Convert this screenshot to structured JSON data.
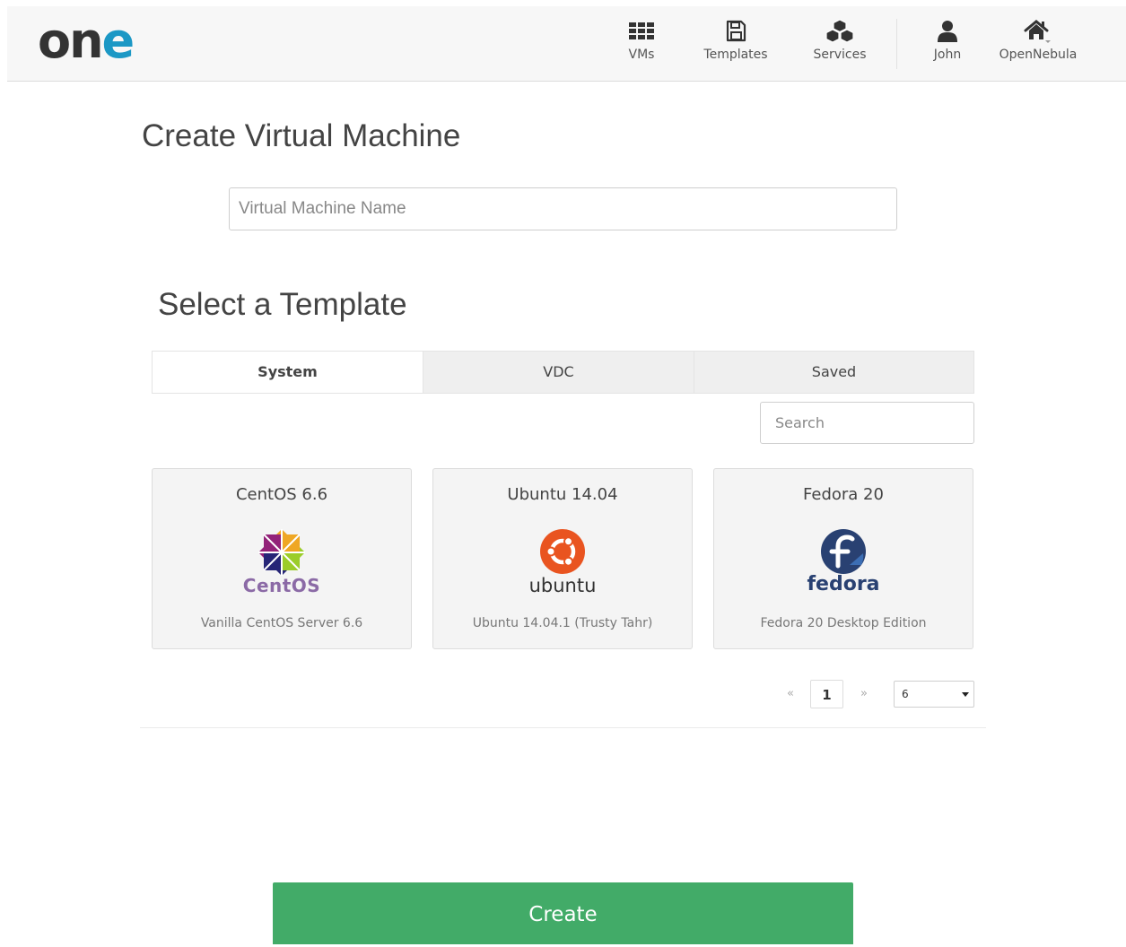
{
  "header": {
    "logo_text_dark": "on",
    "logo_text_accent": "e",
    "nav": [
      {
        "label": "VMs",
        "icon": "grid-icon"
      },
      {
        "label": "Templates",
        "icon": "floppy-icon"
      },
      {
        "label": "Services",
        "icon": "cubes-icon"
      },
      {
        "label": "John",
        "icon": "user-icon"
      },
      {
        "label": "OpenNebula",
        "icon": "home-icon"
      }
    ]
  },
  "main": {
    "title": "Create Virtual Machine",
    "vm_name_placeholder": "Virtual Machine Name",
    "select_title": "Select a Template",
    "tabs": [
      {
        "label": "System",
        "active": true
      },
      {
        "label": "VDC",
        "active": false
      },
      {
        "label": "Saved",
        "active": false
      }
    ],
    "search_placeholder": "Search",
    "templates": [
      {
        "name": "CentOS 6.6",
        "logo_text": "CentOS",
        "description": "Vanilla CentOS Server 6.6"
      },
      {
        "name": "Ubuntu 14.04",
        "logo_text": "ubuntu",
        "description": "Ubuntu 14.04.1 (Trusty Tahr)"
      },
      {
        "name": "Fedora 20",
        "logo_text": "fedora",
        "description": "Fedora 20 Desktop Edition"
      }
    ],
    "pagination": {
      "prev": "«",
      "current": "1",
      "next": "»",
      "page_size": "6"
    },
    "create_label": "Create"
  },
  "colors": {
    "accent_blue": "#1c98c5",
    "create_green": "#42ab68",
    "ubuntu_orange": "#e95420",
    "fedora_blue": "#294172",
    "centos_purple": "#932279"
  }
}
